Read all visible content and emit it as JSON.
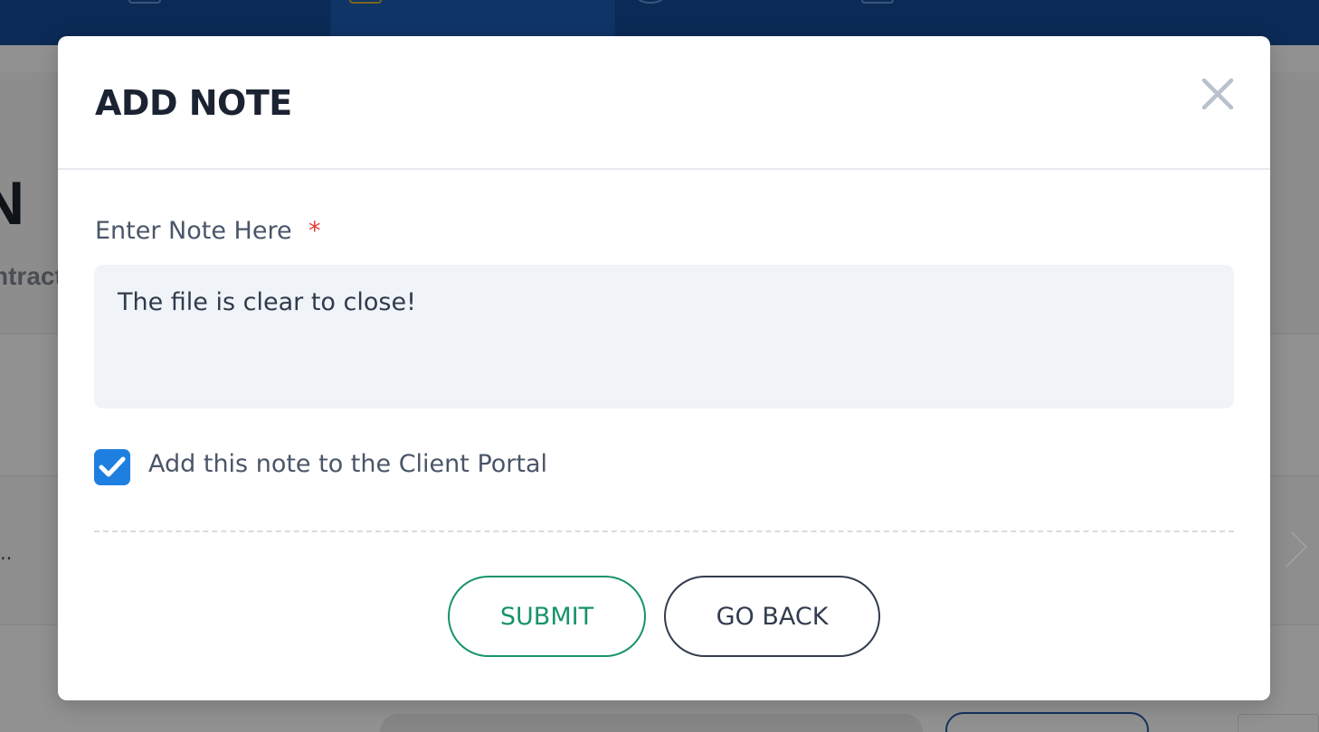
{
  "modal": {
    "title": "ADD NOTE",
    "note_field": {
      "label": "Enter Note Here",
      "required_marker": "*",
      "value": "The file is clear to close!"
    },
    "client_portal_checkbox": {
      "label": "Add this note to the Client Portal",
      "checked": true
    },
    "buttons": {
      "submit": "SUBMIT",
      "go_back": "GO BACK"
    }
  },
  "background": {
    "heading_fragment": "N",
    "subheading_fragment": "ntract",
    "ellipsis_fragment": ".."
  },
  "colors": {
    "topbar": "#0b2a55",
    "submit_accent": "#17936a",
    "checkbox_blue": "#1e7fe0",
    "required_red": "#e53935",
    "title_text": "#1b2333",
    "input_bg": "#f0f3f8"
  },
  "icons": {
    "close": "close-icon",
    "checkmark": "checkmark-icon"
  }
}
